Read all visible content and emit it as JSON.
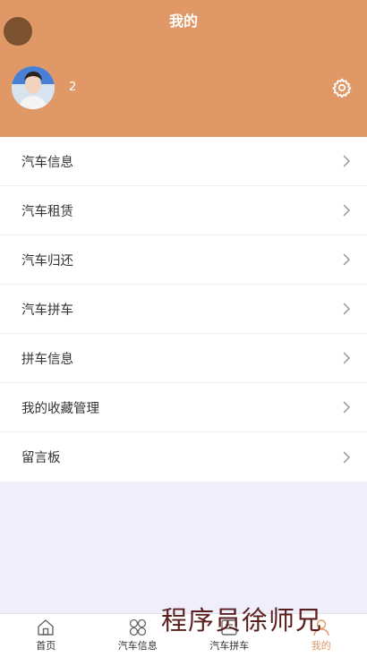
{
  "header": {
    "title": "我的",
    "username": "2"
  },
  "colors": {
    "accent": "#df9866",
    "background": "#efeefa"
  },
  "menu": {
    "items": [
      {
        "label": "汽车信息"
      },
      {
        "label": "汽车租赁"
      },
      {
        "label": "汽车归还"
      },
      {
        "label": "汽车拼车"
      },
      {
        "label": "拼车信息"
      },
      {
        "label": "我的收藏管理"
      },
      {
        "label": "留言板"
      }
    ]
  },
  "tabbar": {
    "items": [
      {
        "label": "首页",
        "icon": "home-icon"
      },
      {
        "label": "汽车信息",
        "icon": "grid-icon"
      },
      {
        "label": "汽车拼车",
        "icon": "document-icon"
      },
      {
        "label": "我的",
        "icon": "user-icon",
        "active": true
      }
    ]
  },
  "watermark": "程序员徐师兄"
}
